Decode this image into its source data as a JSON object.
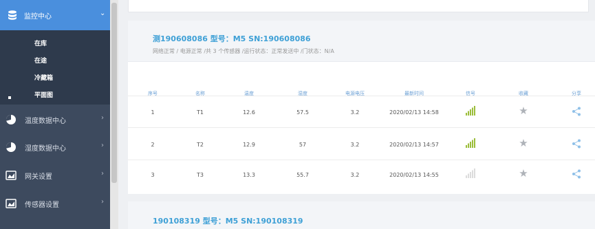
{
  "sidebar": {
    "active": {
      "label": "监控中心",
      "icon": "database-icon"
    },
    "submenu": [
      "在库",
      "在途",
      "冷藏箱",
      "平面图"
    ],
    "items": [
      {
        "label": "温度数据中心",
        "icon": "pie-chart-icon"
      },
      {
        "label": "湿度数据中心",
        "icon": "pie-chart-icon"
      },
      {
        "label": "网关设置",
        "icon": "gateway-icon"
      },
      {
        "label": "传感器设置",
        "icon": "sensor-icon"
      }
    ]
  },
  "device1": {
    "title": "测190608086  型号：M5  SN:190608086",
    "status": "网络正常 / 电源正常 /共 3 个传感器 /运行状态：正常发送中 /门状态：N/A",
    "columns": [
      "序号",
      "名称",
      "温度",
      "湿度",
      "电源电压",
      "最新时间",
      "信号",
      "收藏",
      "分享"
    ],
    "rows": [
      {
        "no": "1",
        "name": "T1",
        "temp": "12.6",
        "humidity": "57.5",
        "voltage": "3.2",
        "time": "2020/02/13 14:58",
        "signal": 4
      },
      {
        "no": "2",
        "name": "T2",
        "temp": "12.9",
        "humidity": "57",
        "voltage": "3.2",
        "time": "2020/02/13 14:57",
        "signal": 4
      },
      {
        "no": "3",
        "name": "T3",
        "temp": "13.3",
        "humidity": "55.7",
        "voltage": "3.2",
        "time": "2020/02/13 14:55",
        "signal": 0
      }
    ]
  },
  "device2": {
    "title": "190108319  型号：M5  SN:190108319"
  },
  "colors": {
    "sidebar_bg": "#3d4a5e",
    "active_bg": "#4a8fdd",
    "title_blue": "#3ea0d6",
    "signal_green": "#9bbd3a"
  }
}
